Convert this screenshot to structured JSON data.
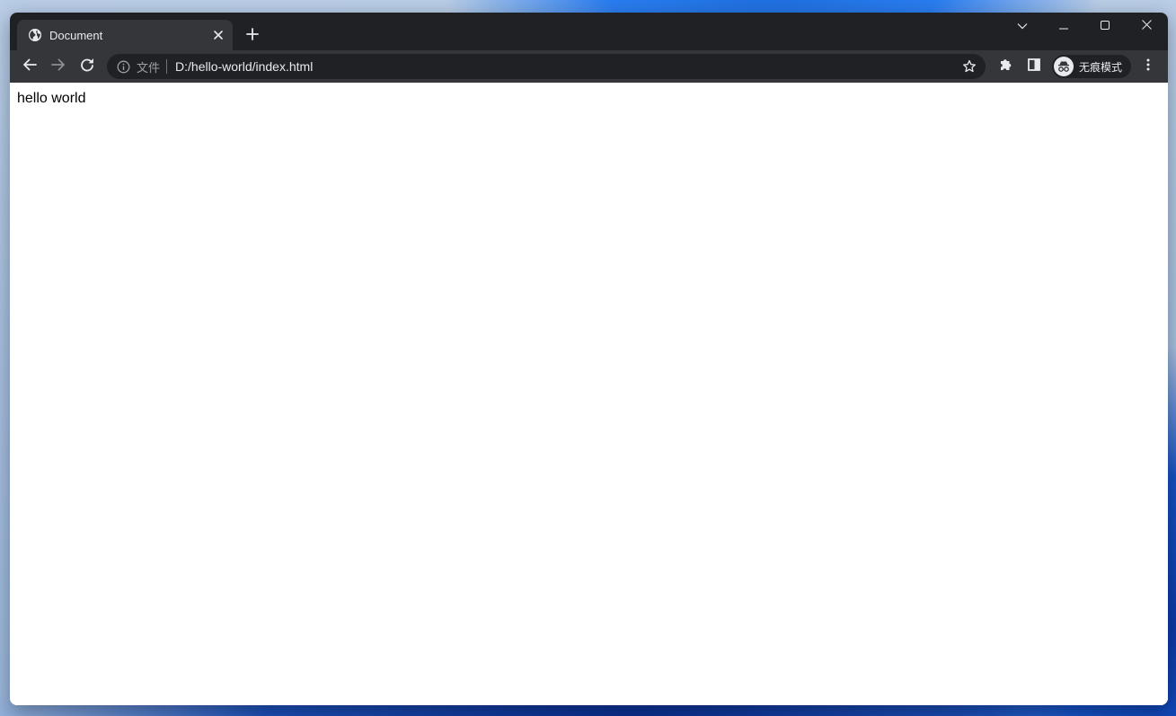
{
  "tab": {
    "title": "Document",
    "favicon": "globe-icon",
    "close_icon": "close-icon"
  },
  "new_tab_icon": "plus-icon",
  "window_controls": [
    "chevron-down-icon",
    "minimize-icon",
    "maximize-icon",
    "close-icon"
  ],
  "toolbar": {
    "back_icon": "arrow-left-icon",
    "forward_icon": "arrow-right-icon",
    "reload_icon": "reload-icon",
    "extensions_icon": "puzzle-icon",
    "side_panel_icon": "side-panel-icon",
    "menu_icon": "kebab-menu-icon"
  },
  "omnibox": {
    "info_icon": "info-icon",
    "scheme_label": "文件",
    "url": "D:/hello-world/index.html",
    "bookmark_icon": "star-icon"
  },
  "profile": {
    "avatar_icon": "incognito-icon",
    "label": "无痕模式"
  },
  "page": {
    "text": "hello world"
  },
  "colors": {
    "titlebar": "#202124",
    "toolbar": "#35363a",
    "omnibox": "#202124",
    "text_light": "#e8eaed",
    "text_dim": "#9aa0a6"
  }
}
